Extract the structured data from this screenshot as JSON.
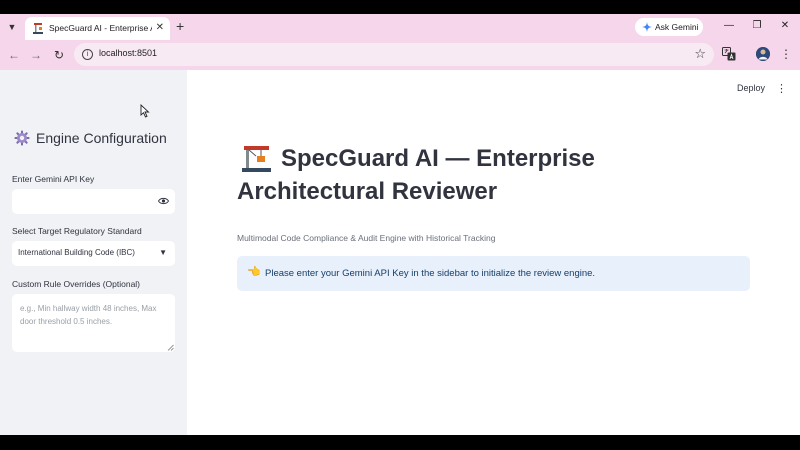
{
  "browser": {
    "tab_title": "SpecGuard AI - Enterprise Architectural Reviewer",
    "tab_favicon": "construction-crane-icon",
    "new_tab_label": "+",
    "ask_gemini_label": "Ask Gemini",
    "url": "localhost:8501",
    "icons": [
      "tab-list-icon",
      "close-icon",
      "back-icon",
      "forward-icon",
      "reload-icon",
      "info-icon",
      "star-icon",
      "translate-icon",
      "profile-icon",
      "menu-icon",
      "minimize-icon",
      "restore-icon",
      "window-close-icon"
    ],
    "colors": {
      "chrome": "#f6d6ea",
      "omnibox": "#f8eaf3"
    }
  },
  "sidebar": {
    "title": "Engine Configuration",
    "title_icon": "gear-icon",
    "api_key": {
      "label": "Enter Gemini API Key",
      "value": "",
      "placeholder": ""
    },
    "standard": {
      "label": "Select Target Regulatory Standard",
      "selected": "International Building Code (IBC)"
    },
    "overrides": {
      "label": "Custom Rule Overrides (Optional)",
      "placeholder": "e.g., Min hallway width 48 inches, Max door threshold 0.5 inches."
    },
    "colors": {
      "background": "#f0f2f6"
    }
  },
  "header": {
    "deploy_label": "Deploy"
  },
  "main": {
    "title": "SpecGuard AI — Enterprise Architectural Reviewer",
    "title_icon": "construction-crane-icon",
    "subtitle": "Multimodal Code Compliance & Audit Engine with Historical Tracking",
    "alert": {
      "icon": "pointing-hand-icon",
      "text": "Please enter your Gemini API Key in the sidebar to initialize the review engine.",
      "colors": {
        "background": "#e8f1fb",
        "text": "#163d6a"
      }
    }
  }
}
